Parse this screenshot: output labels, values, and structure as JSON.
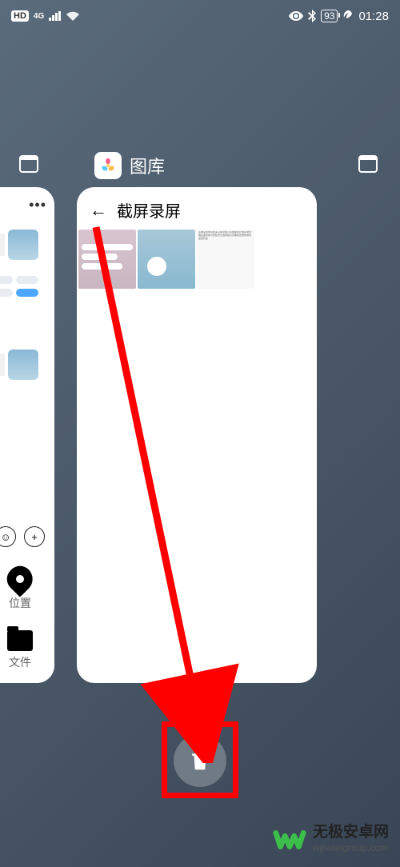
{
  "status_bar": {
    "hd": "HD",
    "network": "4G",
    "battery": "93",
    "time": "01:28"
  },
  "center_app": {
    "title": "图库",
    "album_title": "截屏录屏"
  },
  "left_panel": {
    "location_label": "位置",
    "file_label": "文件"
  },
  "watermark": {
    "title": "无极安卓网",
    "url": "wjhotelgroup.com"
  }
}
